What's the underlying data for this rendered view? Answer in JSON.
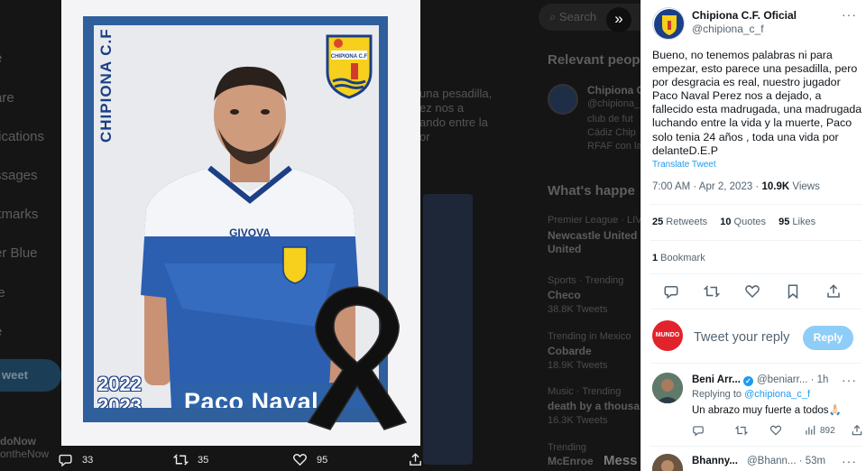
{
  "background": {
    "nav_items": [
      "e",
      "are",
      "fications",
      "ssages",
      "kmarks",
      "er Blue",
      "le",
      "e"
    ],
    "tweet_button": "weet",
    "me_name": "doNow",
    "me_handle": "ontheNow",
    "feed_lines": [
      "una pesadilla,",
      "ez nos a",
      "ando entre la",
      "or"
    ],
    "search_placeholder": "Search",
    "relevant_heading": "Relevant peop",
    "relevant_name": "Chipiona C",
    "relevant_handle": "@chipiona_",
    "relevant_bio": [
      "club de fut",
      "Cádiz Chip",
      "RFAF con la"
    ],
    "whats_happening": "What's happe",
    "trends": [
      {
        "meta": "Premier League · LIVE",
        "title": "Newcastle United v",
        "title2": "United"
      },
      {
        "meta": "Sports · Trending",
        "title": "Checo",
        "count": "38.8K Tweets"
      },
      {
        "meta": "Trending in Mexico",
        "title": "Cobarde",
        "count": "18.9K Tweets"
      },
      {
        "meta": "Music · Trending",
        "title": "death by a thousa",
        "count": "16.3K Tweets"
      },
      {
        "meta": "Trending",
        "title": "McEnroe",
        "count": ""
      }
    ],
    "mess_text": "Mess"
  },
  "card": {
    "side_text": "CHIPIONA C.F",
    "shirt_brand": "GIVOVA",
    "crest_text": "CHIPIONA C.F",
    "season_top": "2022",
    "season_bottom": "2023",
    "player_name": "Paco Naval"
  },
  "media_actions": {
    "replies": "33",
    "retweets": "35",
    "likes": "95"
  },
  "panel": {
    "account_name": "Chipiona C.F. Oficial",
    "account_handle": "@chipiona_c_f",
    "more": "···",
    "tweet_text": "Bueno, no tenemos palabras ni para empezar, esto parece una pesadilla, pero por desgracia es real, nuestro jugador Paco Naval Perez nos a dejado, a fallecido esta madrugada, una madrugada luchando entre la vida y la muerte, Paco solo tenia 24 años , toda una vida por delanteD.E.P",
    "translate": "Translate Tweet",
    "time": "7:00 AM · Apr 2, 2023 · ",
    "views_count": "10.9K",
    "views_label": " Views",
    "retweets_count": "25",
    "retweets_label": " Retweets",
    "quotes_count": "10",
    "quotes_label": " Quotes",
    "likes_count": "95",
    "likes_label": " Likes",
    "bookmark_count": "1",
    "bookmark_label": " Bookmark",
    "reply_avatar_text": "MUNDO NOW",
    "reply_placeholder": "Tweet your reply",
    "reply_button": "Reply",
    "replies": [
      {
        "name": "Beni Arr...",
        "handle": "@beniarr...",
        "time": "· 1h",
        "replying_to_label": "Replying to ",
        "replying_to": "@chipiona_c_f",
        "text": "Un abrazo muy fuerte a todos🙏🏻",
        "views": "892"
      },
      {
        "name": "Bhanny...",
        "handle": "@Bhann...",
        "time": "· 53m"
      }
    ]
  }
}
